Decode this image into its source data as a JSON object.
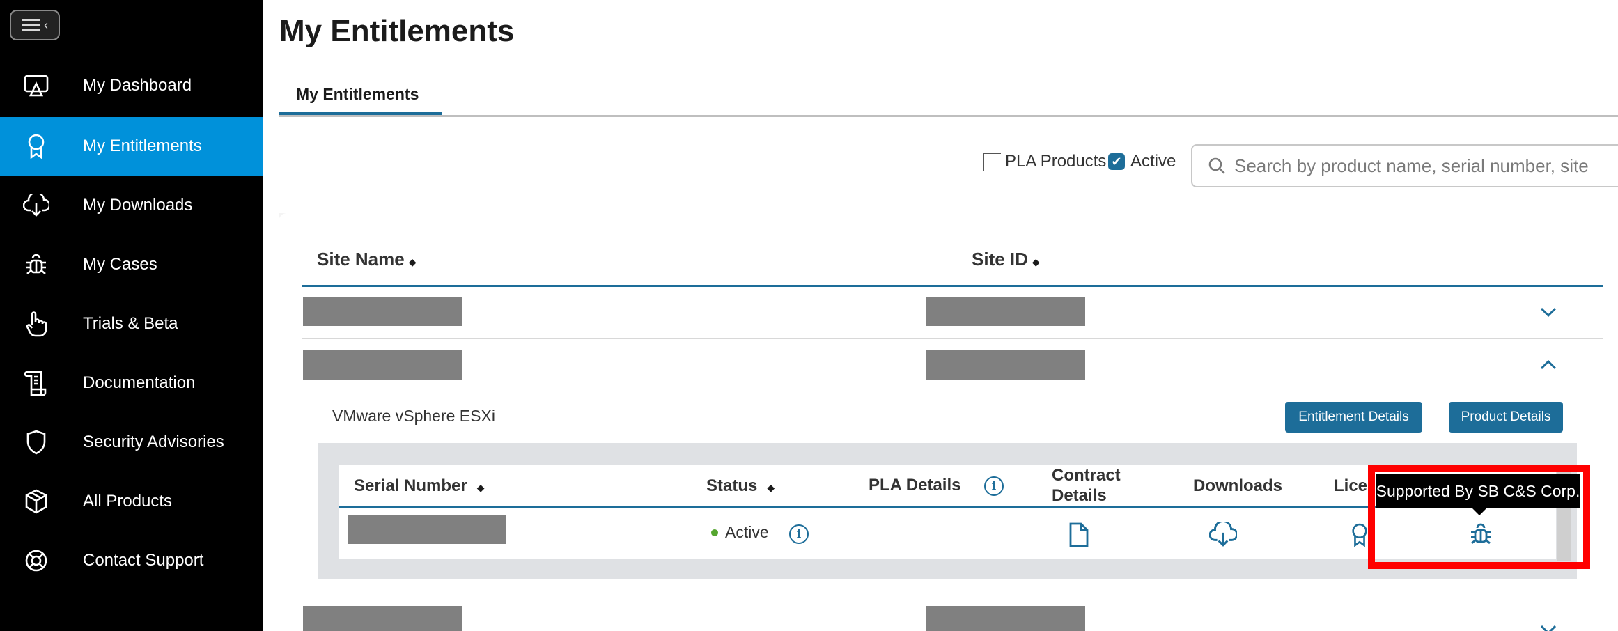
{
  "sidebar": {
    "items": [
      {
        "label": "My Dashboard",
        "icon": "dashboard-icon"
      },
      {
        "label": "My Entitlements",
        "icon": "ribbon-icon",
        "active": true
      },
      {
        "label": "My Downloads",
        "icon": "cloud-download-icon"
      },
      {
        "label": "My Cases",
        "icon": "bug-icon"
      },
      {
        "label": "Trials & Beta",
        "icon": "pointer-hand-icon"
      },
      {
        "label": "Documentation",
        "icon": "scroll-icon"
      },
      {
        "label": "Security Advisories",
        "icon": "shield-icon"
      },
      {
        "label": "All Products",
        "icon": "cube-icon"
      },
      {
        "label": "Contact Support",
        "icon": "lifebuoy-icon"
      }
    ]
  },
  "main": {
    "title": "My Entitlements",
    "tabs": [
      {
        "label": "My Entitlements",
        "active": true
      }
    ]
  },
  "filters": {
    "pla_products": {
      "label": "PLA Products",
      "checked": false
    },
    "active": {
      "label": "Active",
      "checked": true
    }
  },
  "search": {
    "placeholder": "Search by product name, serial number, site"
  },
  "sites_table": {
    "columns": [
      "Site Name",
      "Site ID"
    ],
    "rows": [
      {
        "expanded": false
      },
      {
        "expanded": true
      }
    ]
  },
  "product_section": {
    "name": "VMware vSphere ESXi",
    "entitlement_details_label": "Entitlement Details",
    "product_details_label": "Product Details"
  },
  "serial_table": {
    "columns": {
      "serial_number": "Serial Number",
      "status": "Status",
      "pla_details": "PLA Details",
      "contract_details_line1": "Contract",
      "contract_details_line2": "Details",
      "downloads": "Downloads",
      "licenses": "Lice"
    },
    "rows": [
      {
        "status": "Active"
      }
    ]
  },
  "tooltip": {
    "text": "Supported By SB C&S Corp."
  },
  "colors": {
    "accent": "#0091da",
    "primary_button": "#1d6d99",
    "status_active": "#55a630",
    "highlight_box": "#ff0000"
  }
}
